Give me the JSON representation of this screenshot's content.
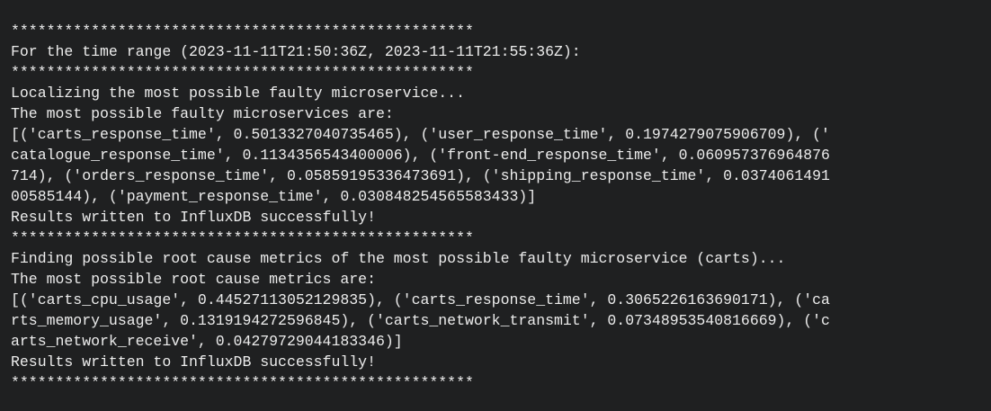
{
  "terminal": {
    "lines": [
      "****************************************************",
      "For the time range (2023-11-11T21:50:36Z, 2023-11-11T21:55:36Z):",
      "****************************************************",
      "Localizing the most possible faulty microservice...",
      "The most possible faulty microservices are:",
      "[('carts_response_time', 0.5013327040735465), ('user_response_time', 0.1974279075906709), ('",
      "catalogue_response_time', 0.1134356543400006), ('front-end_response_time', 0.060957376964876",
      "714), ('orders_response_time', 0.05859195336473691), ('shipping_response_time', 0.0374061491",
      "00585144), ('payment_response_time', 0.030848254565583433)]",
      "Results written to InfluxDB successfully!",
      "****************************************************",
      "Finding possible root cause metrics of the most possible faulty microservice (carts)...",
      "The most possible root cause metrics are:",
      "[('carts_cpu_usage', 0.44527113052129835), ('carts_response_time', 0.3065226163690171), ('ca",
      "rts_memory_usage', 0.1319194272596845), ('carts_network_transmit', 0.07348953540816669), ('c",
      "arts_network_receive', 0.04279729044183346)]",
      "Results written to InfluxDB successfully!",
      "****************************************************"
    ]
  }
}
